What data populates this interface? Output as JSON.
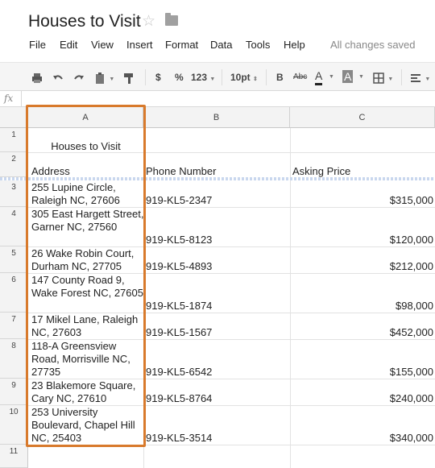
{
  "title_bar": {
    "title": "Houses to Visit",
    "star_icon": "star-icon",
    "folder_icon": "folder-icon"
  },
  "menu": {
    "items": [
      "File",
      "Edit",
      "View",
      "Insert",
      "Format",
      "Data",
      "Tools",
      "Help"
    ],
    "status": "All changes saved"
  },
  "toolbar": {
    "icons": [
      "print-icon",
      "undo-icon",
      "redo-icon",
      "paint-format-icon",
      "borders-icon",
      "align-icon"
    ],
    "currency": "$",
    "percent": "%",
    "number_format": "123",
    "font_size": "10pt",
    "bold": "B",
    "strikethrough": "Abc",
    "text_color": "A",
    "fill_color": "A"
  },
  "formula_bar": {
    "label": "fx",
    "value": ""
  },
  "columns": [
    "A",
    "B",
    "C"
  ],
  "rows": [
    "1",
    "2",
    "3",
    "4",
    "5",
    "6",
    "7",
    "8",
    "9",
    "10",
    "11"
  ],
  "cells": {
    "r1": {
      "a": "Houses to Visit"
    },
    "r2": {
      "a": "Address",
      "b": "Phone Number",
      "c": "Asking Price"
    },
    "r3": {
      "a": "255 Lupine Circle, Raleigh NC, 27606",
      "b": "919-KL5-2347",
      "c": "$315,000"
    },
    "r4": {
      "a": "305 East Hargett Street, Garner NC, 27560",
      "b": "919-KL5-8123",
      "c": "$120,000"
    },
    "r5": {
      "a": "26 Wake Robin Court, Durham NC, 27705",
      "b": "919-KL5-4893",
      "c": "$212,000"
    },
    "r6": {
      "a": "147 County Road 9, Wake Forest NC, 27605",
      "b": "919-KL5-1874",
      "c": "$98,000"
    },
    "r7": {
      "a": "17 Mikel Lane, Raleigh NC, 27603",
      "b": "919-KL5-1567",
      "c": "$452,000"
    },
    "r8": {
      "a": "118-A Greensview Road, Morrisville NC, 27735",
      "b": "919-KL5-6542",
      "c": "$155,000"
    },
    "r9": {
      "a": "23 Blakemore Square, Cary NC, 27610",
      "b": "919-KL5-8764",
      "c": "$240,000"
    },
    "r10": {
      "a": "253 University Boulevard, Chapel Hill NC, 25403",
      "b": "919-KL5-3514",
      "c": "$340,000"
    }
  },
  "colors": {
    "highlight": "#d87a2c",
    "freeze_line": "#c9d7ee"
  }
}
